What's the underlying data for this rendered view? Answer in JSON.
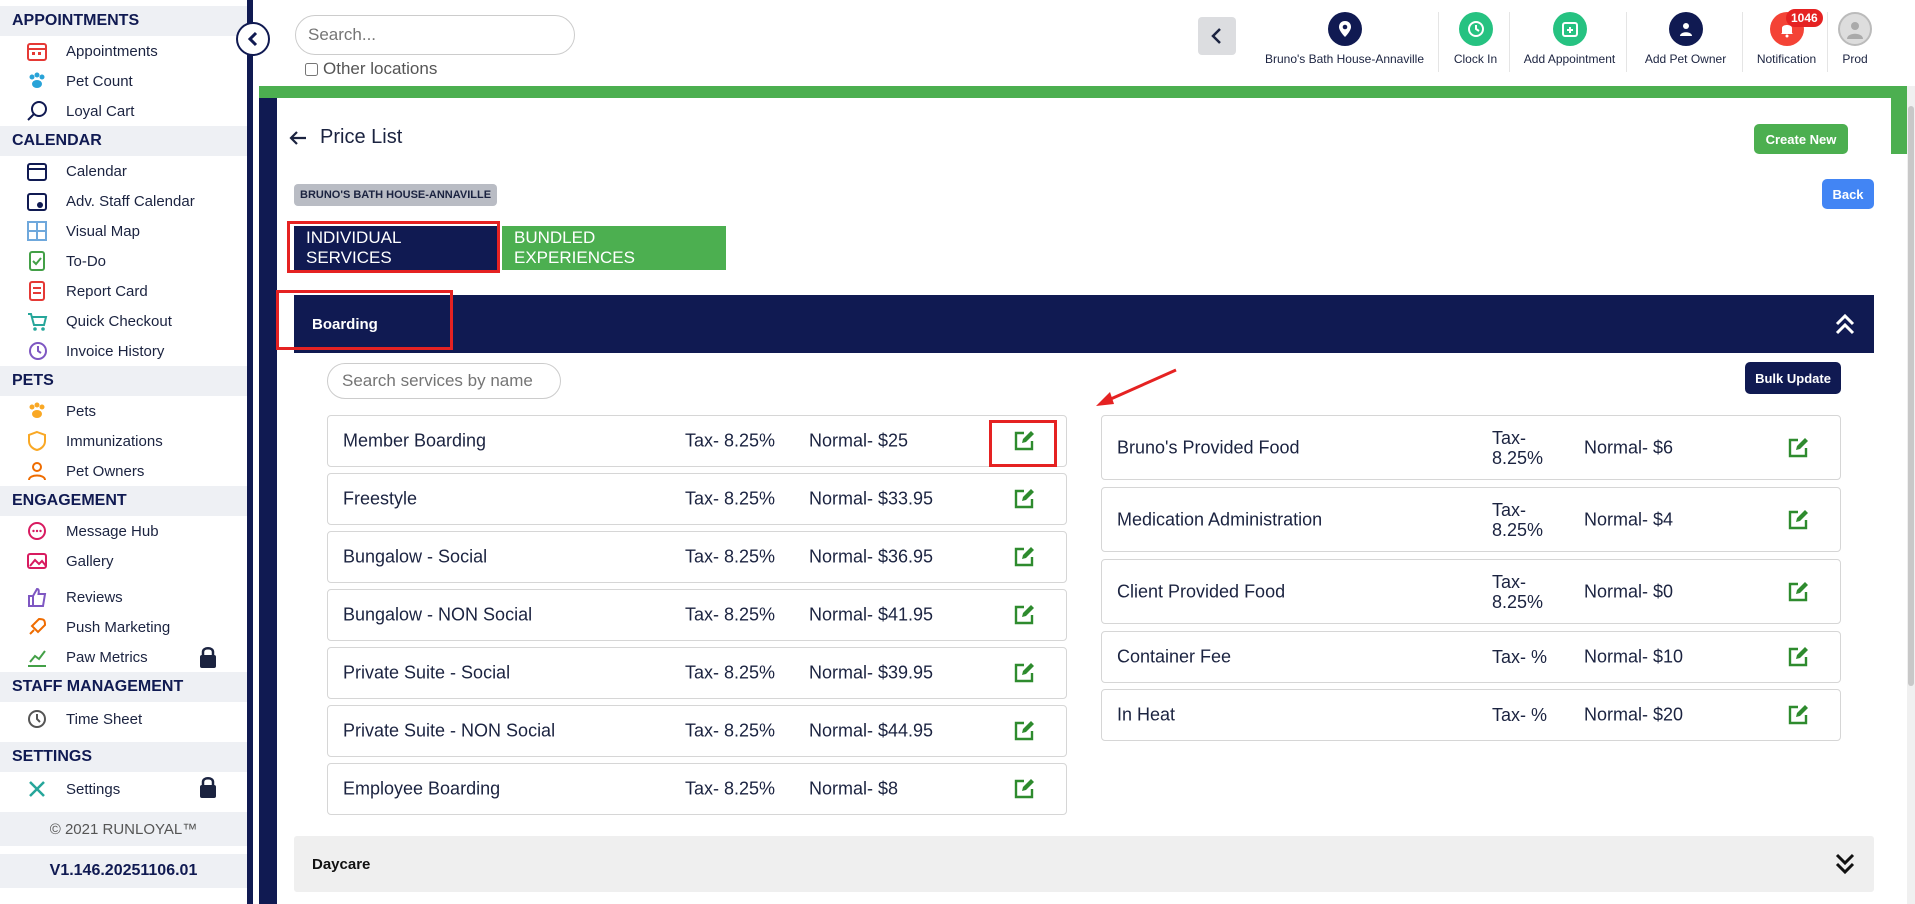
{
  "sidebar": {
    "sections": [
      {
        "title": "APPOINTMENTS",
        "items": [
          "Appointments",
          "Pet Count",
          "Loyal Cart"
        ]
      },
      {
        "title": "CALENDAR",
        "items": [
          "Calendar",
          "Adv. Staff Calendar",
          "Visual Map",
          "To-Do",
          "Report Card",
          "Quick Checkout",
          "Invoice History"
        ]
      },
      {
        "title": "PETS",
        "items": [
          "Pets",
          "Immunizations",
          "Pet Owners"
        ]
      },
      {
        "title": "ENGAGEMENT",
        "items": [
          "Message Hub",
          "Gallery",
          "Reviews",
          "Push Marketing",
          "Paw Metrics"
        ]
      },
      {
        "title": "STAFF MANAGEMENT",
        "items": [
          "Time Sheet"
        ]
      },
      {
        "title": "SETTINGS",
        "items": [
          "Settings"
        ]
      }
    ],
    "copyright": "© 2021  RUNLOYAL™",
    "version": "V1.146.20251106.01"
  },
  "topbar": {
    "search_placeholder": "Search...",
    "other_locations": "Other locations",
    "location_name": "Bruno's Bath House-Annaville",
    "clock_in": "Clock In",
    "add_appointment": "Add Appointment",
    "add_pet_owner": "Add Pet Owner",
    "notification": "Notification",
    "notification_count": "1046",
    "profile": "Prod"
  },
  "page": {
    "title": "Price List",
    "create_new": "Create New",
    "back": "Back",
    "location_chip": "BRUNO'S BATH HOUSE-ANNAVILLE",
    "tabs": [
      "INDIVIDUAL SERVICES",
      "BUNDLED EXPERIENCES"
    ],
    "section_boarding": "Boarding",
    "section_daycare": "Daycare",
    "search_services_placeholder": "Search services by name",
    "bulk_update": "Bulk Update"
  },
  "services_left": [
    {
      "name": "Member Boarding",
      "tax": "Tax- 8.25%",
      "normal": "Normal- $25"
    },
    {
      "name": "Freestyle",
      "tax": "Tax- 8.25%",
      "normal": "Normal- $33.95"
    },
    {
      "name": "Bungalow - Social",
      "tax": "Tax- 8.25%",
      "normal": "Normal- $36.95"
    },
    {
      "name": "Bungalow - NON Social",
      "tax": "Tax- 8.25%",
      "normal": "Normal- $41.95"
    },
    {
      "name": "Private Suite - Social",
      "tax": "Tax- 8.25%",
      "normal": "Normal- $39.95"
    },
    {
      "name": "Private Suite - NON Social",
      "tax": "Tax- 8.25%",
      "normal": "Normal- $44.95"
    },
    {
      "name": "Employee Boarding",
      "tax": "Tax- 8.25%",
      "normal": "Normal- $8"
    }
  ],
  "services_right": [
    {
      "name": "Bruno's Provided Food",
      "tax": "Tax- 8.25%",
      "normal": "Normal- $6"
    },
    {
      "name": "Medication Administration",
      "tax": "Tax- 8.25%",
      "normal": "Normal- $4"
    },
    {
      "name": "Client Provided Food",
      "tax": "Tax- 8.25%",
      "normal": "Normal- $0"
    },
    {
      "name": "Container Fee",
      "tax": "Tax- %",
      "normal": "Normal- $10"
    },
    {
      "name": "In Heat",
      "tax": "Tax- %",
      "normal": "Normal- $20"
    }
  ],
  "colors": {
    "navy": "#101a52",
    "green": "#4caf50",
    "blue": "#4285f4",
    "red": "#e52222"
  }
}
